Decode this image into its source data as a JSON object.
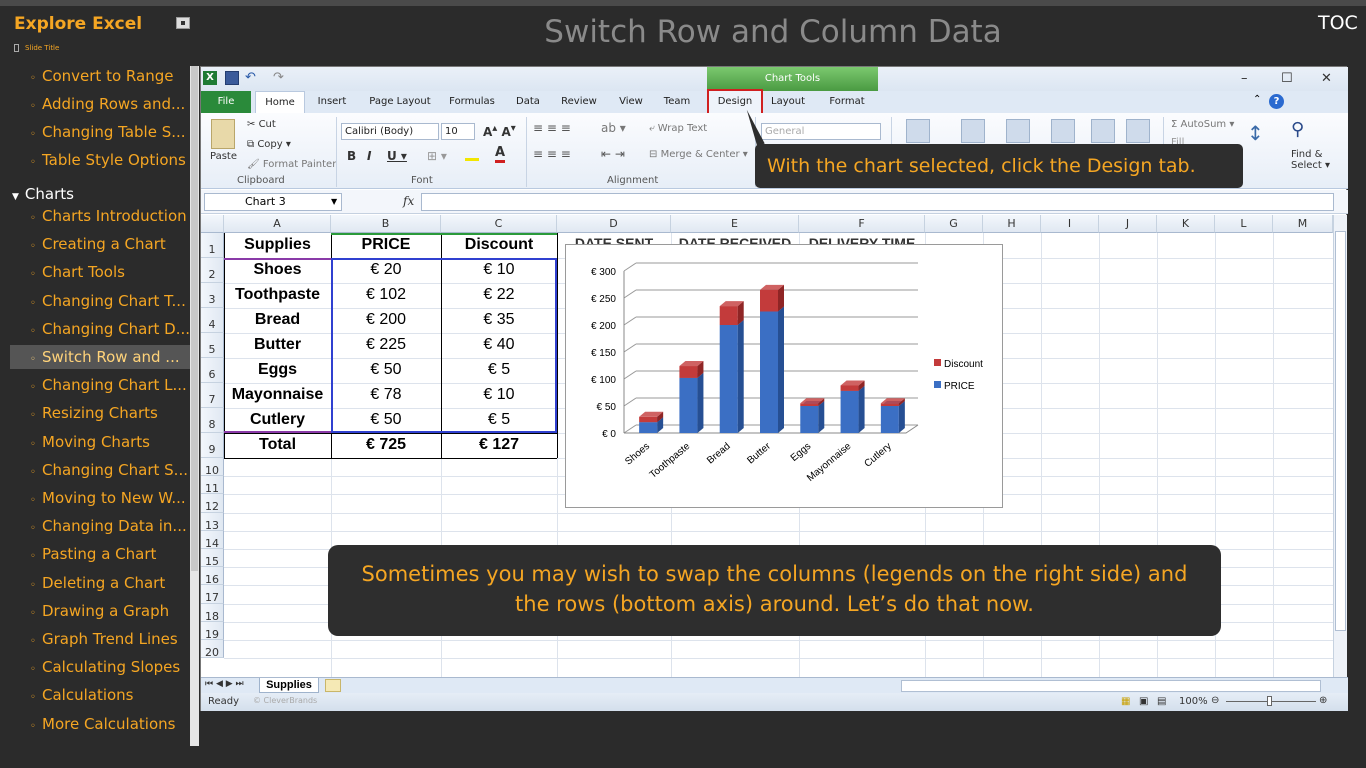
{
  "app_title": "Explore Excel",
  "slide_title_label": "Slide Title",
  "slide_heading": "Switch Row and Column Data",
  "toc_button": "TOC",
  "toc": {
    "items_before": [
      "Convert to Range",
      "Adding Rows and...",
      "Changing Table S...",
      "Table Style Options"
    ],
    "section": "Charts",
    "items": [
      "Charts Introduction",
      "Creating a Chart",
      "Chart Tools",
      "Changing Chart T...",
      "Changing Chart D...",
      "Switch Row and ...",
      "Changing Chart L...",
      "Resizing Charts",
      "Moving Charts",
      "Changing Chart S...",
      "Moving to New W...",
      "Changing Data in...",
      "Pasting a Chart",
      "Deleting a Chart",
      "Drawing a Graph",
      "Graph Trend Lines",
      "Calculating Slopes",
      "Calculations",
      "More Calculations"
    ],
    "selected_index": 5
  },
  "excel": {
    "chart_tools_label": "Chart Tools",
    "tabs": [
      "File",
      "Home",
      "Insert",
      "Page Layout",
      "Formulas",
      "Data",
      "Review",
      "View",
      "Team",
      "Design",
      "Layout",
      "Format"
    ],
    "clipboard": {
      "paste": "Paste",
      "cut": "Cut",
      "copy": "Copy",
      "format_painter": "Format Painter",
      "label": "Clipboard"
    },
    "font": {
      "name": "Calibri (Body)",
      "size": "10",
      "label": "Font"
    },
    "alignment": {
      "wrap_text": "Wrap Text",
      "merge_center": "Merge & Center",
      "label": "Alignment"
    },
    "number_format": "General",
    "editing": {
      "autosum": "AutoSum",
      "fill": "Fill",
      "sort_filter": "ort &\nlter",
      "find_select": "Find &\nSelect"
    },
    "name_box": "Chart 3",
    "fx": "fx",
    "columns": [
      "A",
      "B",
      "C",
      "D",
      "E",
      "F",
      "G",
      "H",
      "I",
      "J",
      "K",
      "L",
      "M"
    ],
    "rows": [
      "1",
      "2",
      "3",
      "4",
      "5",
      "6",
      "7",
      "8",
      "9",
      "10",
      "11",
      "12",
      "13",
      "14",
      "15",
      "16",
      "17",
      "18",
      "19",
      "20"
    ],
    "hidden_headers": [
      "DATE SENT",
      "DATE RECEIVED",
      "DELIVERY TIME"
    ],
    "table": {
      "headers": [
        "Supplies",
        "PRICE",
        "Discount"
      ],
      "rows": [
        [
          "Shoes",
          "€ 20",
          "€ 10"
        ],
        [
          "Toothpaste",
          "€ 102",
          "€ 22"
        ],
        [
          "Bread",
          "€ 200",
          "€ 35"
        ],
        [
          "Butter",
          "€ 225",
          "€ 40"
        ],
        [
          "Eggs",
          "€ 50",
          "€ 5"
        ],
        [
          "Mayonnaise",
          "€ 78",
          "€ 10"
        ],
        [
          "Cutlery",
          "€ 50",
          "€ 5"
        ],
        [
          "Total",
          "€ 725",
          "€ 127"
        ]
      ]
    },
    "sheet_tab": "Supplies",
    "status": "Ready",
    "status_brand": "© CleverBrands",
    "zoom": "100%"
  },
  "chart_data": {
    "type": "bar",
    "stacked": true,
    "three_d": true,
    "categories": [
      "Shoes",
      "Toothpaste",
      "Bread",
      "Butter",
      "Eggs",
      "Mayonnaise",
      "Cutlery"
    ],
    "series": [
      {
        "name": "PRICE",
        "values": [
          20,
          102,
          200,
          225,
          50,
          78,
          50
        ],
        "color": "#3b6fc4"
      },
      {
        "name": "Discount",
        "values": [
          10,
          22,
          35,
          40,
          5,
          10,
          5
        ],
        "color": "#c33b3b"
      }
    ],
    "yticks": [
      "€ 0",
      "€ 50",
      "€ 100",
      "€ 150",
      "€ 200",
      "€ 250",
      "€ 300"
    ],
    "ylim": [
      0,
      300
    ],
    "legend_position": "right",
    "grid": true
  },
  "callouts": {
    "design": "With the chart selected, click the Design tab.",
    "main": "Sometimes you may wish to swap the columns (legends on the right side) and the rows (bottom axis) around. Let’s do that now."
  }
}
